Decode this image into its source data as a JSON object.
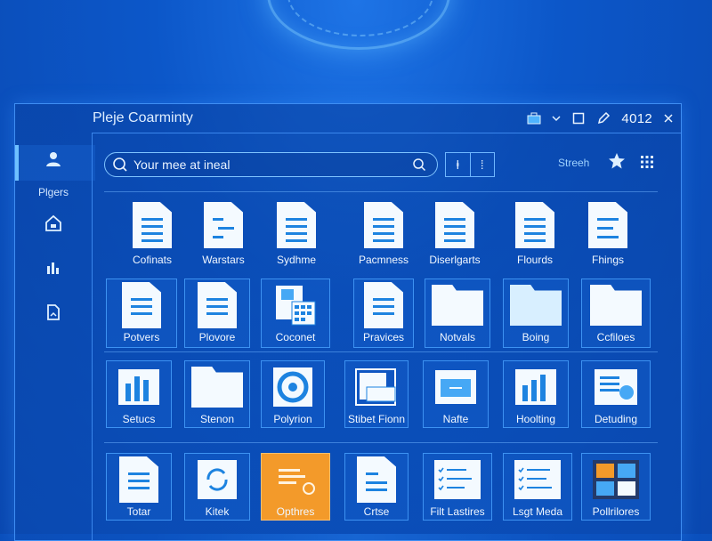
{
  "window": {
    "title": "Pleje Coarminty",
    "counter": "4012"
  },
  "titlebar_icons": [
    "briefcase-icon",
    "chevron-down-icon",
    "square-icon",
    "pencil-icon",
    "close-icon"
  ],
  "sidebar": {
    "items": [
      {
        "icon": "user-icon",
        "label": "Plgers"
      },
      {
        "icon": "home-icon",
        "label": ""
      },
      {
        "icon": "chart-icon",
        "label": ""
      },
      {
        "icon": "document-icon",
        "label": ""
      }
    ]
  },
  "search": {
    "placeholder": "Your mee at ineal"
  },
  "toolbar": {
    "stretch_label": "Streeh",
    "btn1": "ⱡ",
    "btn2": "⁞"
  },
  "rows": [
    {
      "labels": [
        "Cofinats",
        "Warstars",
        "Sydhme",
        "Pacmness",
        "Diserlgarts",
        "Flourds",
        "Fhings"
      ]
    },
    {
      "labels": [
        "Potvers",
        "Plovore",
        "Coconet",
        "Pravices",
        "Notvals",
        "Boing",
        "Ccfiloes"
      ]
    },
    {
      "labels": [
        "Setucs",
        "Stenon",
        "Polyrion",
        "Stibet Fionn",
        "Nafte",
        "Hoolting",
        "Detuding"
      ]
    },
    {
      "labels": [
        "Totar",
        "Kitek",
        "Opthres",
        "Crtse",
        "Filt Lastires",
        "Lsgt Meda",
        "Pollrilores"
      ]
    }
  ],
  "colors": {
    "accent": "#6fc1ff",
    "orange_tile": "#f39a2a",
    "background": "#0c57c9"
  }
}
